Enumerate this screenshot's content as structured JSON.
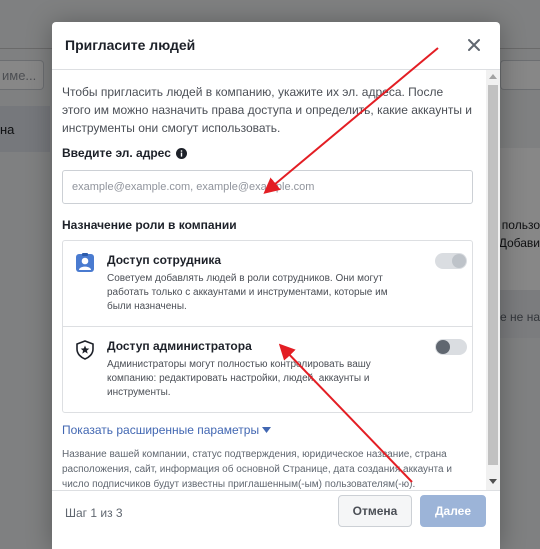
{
  "background": {
    "search_text": "име...",
    "row_text": "на",
    "right_text_1": "пользо",
    "right_text_2": "Добави",
    "right_text_3": "е не на"
  },
  "dialog": {
    "title": "Пригласите людей",
    "intro": "Чтобы пригласить людей в компанию, укажите их эл. адреса. После этого им можно назначить права доступа и определить, какие аккаунты и инструменты они смогут использовать.",
    "email_label": "Введите эл. адрес",
    "email_value": "",
    "email_placeholder": "example@example.com, example@example.com",
    "role_heading": "Назначение роли в компании",
    "roles": [
      {
        "title": "Доступ сотрудника",
        "description": "Советуем добавлять людей в роли сотрудников. Они могут работать только с аккаунтами и инструментами, которые им были назначены.",
        "icon": "employee-badge-icon",
        "toggle_on": true,
        "toggle_disabled": true
      },
      {
        "title": "Доступ администратора",
        "description": "Администраторы могут полностью контролировать вашу компанию: редактировать настройки, людей, аккаунты и инструменты.",
        "icon": "admin-shield-icon",
        "toggle_on": false,
        "toggle_disabled": false
      }
    ],
    "advanced_link": "Показать расширенные параметры",
    "advanced_desc": "Название вашей компании, статус подтверждения, юридическое название, страна расположения, сайт, информация об основной Странице, дата создания аккаунта и число подписчиков будут известны приглашенным(-ым) пользователям(-ю)."
  },
  "footer": {
    "step": "Шаг 1 из 3",
    "cancel_label": "Отмена",
    "next_label": "Далее"
  },
  "colors": {
    "link": "#4267b2",
    "primary_disabled": "#9cb4d8",
    "annotation_arrow": "#e31e24"
  },
  "icons": [
    "close-icon",
    "info-icon",
    "employee-badge-icon",
    "admin-shield-icon",
    "caret-down-icon"
  ]
}
